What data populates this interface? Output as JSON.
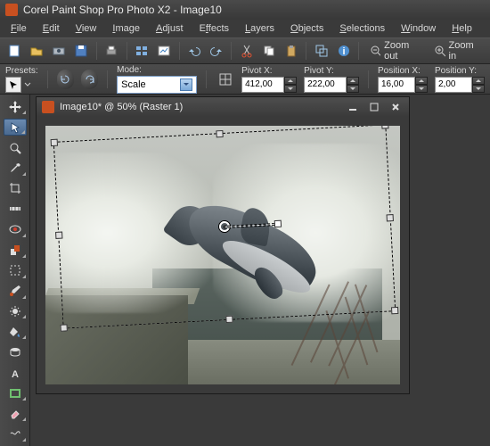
{
  "app": {
    "title": "Corel Paint Shop Pro Photo X2 - Image10"
  },
  "menu": {
    "items": [
      {
        "label": "File",
        "u": "F"
      },
      {
        "label": "Edit",
        "u": "E"
      },
      {
        "label": "View",
        "u": "V"
      },
      {
        "label": "Image",
        "u": "I"
      },
      {
        "label": "Adjust",
        "u": "A"
      },
      {
        "label": "Effects",
        "u": "f"
      },
      {
        "label": "Layers",
        "u": "L"
      },
      {
        "label": "Objects",
        "u": "O"
      },
      {
        "label": "Selections",
        "u": "S"
      },
      {
        "label": "Window",
        "u": "W"
      },
      {
        "label": "Help",
        "u": "H"
      }
    ]
  },
  "toolbar1": {
    "zoom_out": "Zoom out",
    "zoom_in": "Zoom in"
  },
  "options": {
    "presets_label": "Presets:",
    "mode_label": "Mode:",
    "mode_value": "Scale",
    "pivotx_label": "Pivot X:",
    "pivotx_value": "412,00",
    "pivoty_label": "Pivot Y:",
    "pivoty_value": "222,00",
    "posx_label": "Position X:",
    "posx_value": "16,00",
    "posy_label": "Position Y:",
    "posy_value": "2,00"
  },
  "doc": {
    "title": "Image10*  @   50% (Raster 1)"
  },
  "tools": {
    "names": [
      "pan",
      "pick",
      "zoom",
      "dropper",
      "crop",
      "straighten",
      "redeye",
      "clone",
      "scratch",
      "paintbrush",
      "airbrush",
      "lighten",
      "flood",
      "text",
      "shape",
      "eraser",
      "pen",
      "colorchanger"
    ]
  }
}
